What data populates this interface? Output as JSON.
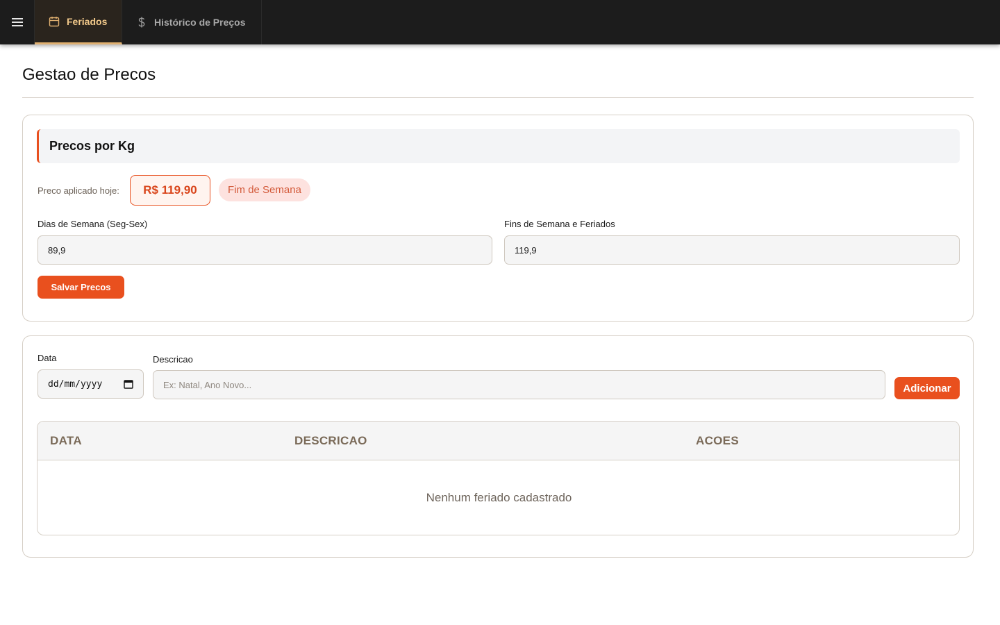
{
  "nav": {
    "tabs": [
      {
        "label": "Feriados",
        "icon": "calendar-icon",
        "active": true
      },
      {
        "label": "Histórico de Preços",
        "icon": "dollar-icon",
        "active": false
      }
    ]
  },
  "page": {
    "title": "Gestao de Precos"
  },
  "prices": {
    "section_title": "Precos por Kg",
    "applied_label": "Preco aplicado hoje:",
    "applied_value": "R$ 119,90",
    "applied_badge": "Fim de Semana",
    "weekday_label": "Dias de Semana (Seg-Sex)",
    "weekday_value": "89,9",
    "weekend_label": "Fins de Semana e Feriados",
    "weekend_value": "119,9",
    "save_label": "Salvar Precos"
  },
  "holidays": {
    "date_label": "Data",
    "date_placeholder": "dd/mm/yyyy",
    "description_label": "Descricao",
    "description_placeholder": "Ex: Natal, Ano Novo...",
    "add_label": "Adicionar",
    "table": {
      "headers": [
        "DATA",
        "DESCRICAO",
        "ACOES"
      ],
      "rows": [],
      "empty_text": "Nenhum feriado cadastrado"
    }
  },
  "colors": {
    "accent": "#e9501e",
    "topbar": "#1c1c1c",
    "active_tab_text": "#f2c98a"
  }
}
